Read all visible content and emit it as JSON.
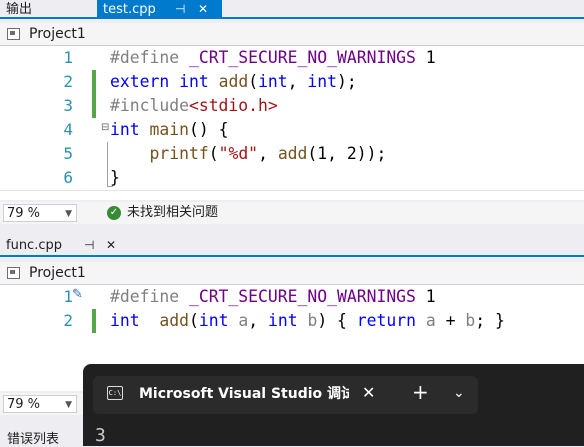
{
  "top_tabs": {
    "output_label": "输出",
    "active_file": "test.cpp",
    "pin": "⊣",
    "close": "✕"
  },
  "top_nav": {
    "project": "Project1"
  },
  "top_editor": {
    "lines": [
      {
        "num": "1",
        "parts": [
          {
            "t": "#define ",
            "c": "pp"
          },
          {
            "t": "_CRT_SECURE_NO_WARNINGS",
            "c": "macro"
          },
          {
            "t": " 1",
            "c": "plain"
          }
        ]
      },
      {
        "num": "2",
        "parts": [
          {
            "t": "extern",
            "c": "kw"
          },
          {
            "t": " ",
            "c": "plain"
          },
          {
            "t": "int",
            "c": "kw"
          },
          {
            "t": " ",
            "c": "plain"
          },
          {
            "t": "add",
            "c": "fn"
          },
          {
            "t": "(",
            "c": "plain"
          },
          {
            "t": "int",
            "c": "kw"
          },
          {
            "t": ", ",
            "c": "plain"
          },
          {
            "t": "int",
            "c": "kw"
          },
          {
            "t": ");",
            "c": "plain"
          }
        ]
      },
      {
        "num": "3",
        "parts": [
          {
            "t": "#include",
            "c": "pp"
          },
          {
            "t": "<stdio.h>",
            "c": "str"
          }
        ]
      },
      {
        "num": "4",
        "parts": [
          {
            "t": "int",
            "c": "kw"
          },
          {
            "t": " ",
            "c": "plain"
          },
          {
            "t": "main",
            "c": "fn"
          },
          {
            "t": "() {",
            "c": "plain"
          }
        ]
      },
      {
        "num": "5",
        "parts": [
          {
            "t": "    ",
            "c": "plain"
          },
          {
            "t": "printf",
            "c": "fn"
          },
          {
            "t": "(",
            "c": "plain"
          },
          {
            "t": "\"%d\"",
            "c": "str"
          },
          {
            "t": ", ",
            "c": "plain"
          },
          {
            "t": "add",
            "c": "fn"
          },
          {
            "t": "(1, 2));",
            "c": "plain"
          }
        ]
      },
      {
        "num": "6",
        "parts": [
          {
            "t": "}",
            "c": "plain"
          }
        ]
      }
    ]
  },
  "top_status": {
    "zoom": "79 %",
    "issues": "未找到相关问题"
  },
  "bottom_tabs": {
    "active_file": "func.cpp",
    "pin": "⊣",
    "close": "✕"
  },
  "bottom_nav": {
    "project": "Project1"
  },
  "bottom_editor": {
    "lines": [
      {
        "num": "1",
        "parts": [
          {
            "t": "#define ",
            "c": "pp"
          },
          {
            "t": "_CRT_SECURE_NO_WARNINGS",
            "c": "macro"
          },
          {
            "t": " 1",
            "c": "plain"
          }
        ]
      },
      {
        "num": "2",
        "parts": [
          {
            "t": "int",
            "c": "kw"
          },
          {
            "t": "  ",
            "c": "plain"
          },
          {
            "t": "add",
            "c": "fn"
          },
          {
            "t": "(",
            "c": "plain"
          },
          {
            "t": "int",
            "c": "kw"
          },
          {
            "t": " ",
            "c": "plain"
          },
          {
            "t": "a",
            "c": "param"
          },
          {
            "t": ", ",
            "c": "plain"
          },
          {
            "t": "int",
            "c": "kw"
          },
          {
            "t": " ",
            "c": "plain"
          },
          {
            "t": "b",
            "c": "param"
          },
          {
            "t": ") { ",
            "c": "plain"
          },
          {
            "t": "return",
            "c": "kw"
          },
          {
            "t": " ",
            "c": "plain"
          },
          {
            "t": "a",
            "c": "param"
          },
          {
            "t": " + ",
            "c": "plain"
          },
          {
            "t": "b",
            "c": "param"
          },
          {
            "t": "; }",
            "c": "plain"
          }
        ]
      }
    ]
  },
  "bottom_status": {
    "zoom": "79 %"
  },
  "error_list": {
    "label": "错误列表"
  },
  "console": {
    "title": "Microsoft Visual Studio 调试控",
    "close": "✕",
    "new_tab": "+",
    "dropdown": "⌄",
    "icon_text": "C:\\",
    "output": "3"
  },
  "colors": {
    "accent": "#007acc",
    "keyword": "#0000ff",
    "macro": "#6f008a",
    "string": "#a31515",
    "function": "#74531f",
    "change_bar": "#57a64a"
  }
}
